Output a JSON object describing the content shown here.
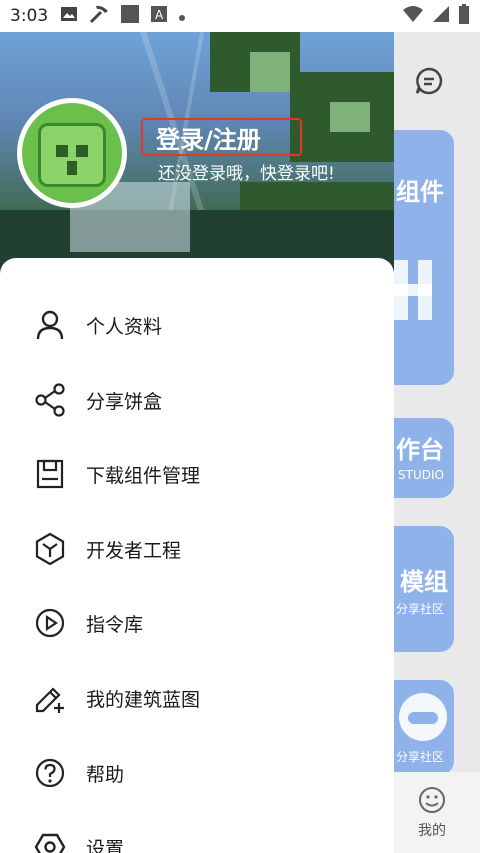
{
  "status_bar": {
    "time": "3:03",
    "icons": [
      "image-icon",
      "pickaxe-icon",
      "square-icon",
      "a-box-icon",
      "dot-icon",
      "wifi-icon",
      "signal-icon",
      "battery-icon"
    ]
  },
  "drawer": {
    "header": {
      "login_title": "登录/注册",
      "login_subtitle": "还没登录哦，快登录吧!"
    },
    "menu": [
      {
        "label": "个人资料",
        "icon": "person-icon"
      },
      {
        "label": "分享饼盒",
        "icon": "share-icon"
      },
      {
        "label": "下载组件管理",
        "icon": "save-icon"
      },
      {
        "label": "开发者工程",
        "icon": "cube-icon"
      },
      {
        "label": "指令库",
        "icon": "play-circle-icon"
      },
      {
        "label": "我的建筑蓝图",
        "icon": "pencil-plus-icon"
      },
      {
        "label": "帮助",
        "icon": "help-icon"
      },
      {
        "label": "设置",
        "icon": "settings-icon"
      }
    ]
  },
  "background_app": {
    "card1_text": "组件",
    "card2_text": "作台",
    "card2_sub": "STUDIO",
    "card3_text": "模组",
    "card3_sub": "分享社区",
    "card4_sub": "分享社区",
    "bottom_tab_label": "我的"
  },
  "colors": {
    "accent_red": "#e8342a",
    "card_blue": "#8fb2ea",
    "drawer_bg": "#ffffff"
  }
}
